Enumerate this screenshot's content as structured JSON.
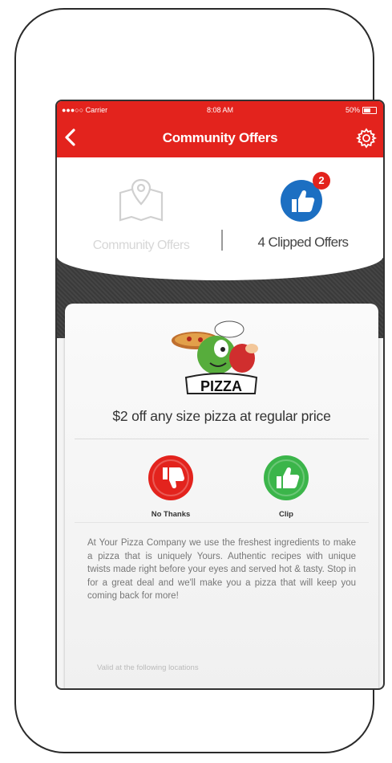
{
  "status_bar": {
    "carrier": "●●●○○ Carrier",
    "time": "8:08 AM",
    "battery": "50%"
  },
  "nav": {
    "title": "Community Offers"
  },
  "tabs": {
    "community": {
      "label": "Community Offers"
    },
    "clipped": {
      "label": "4 Clipped Offers",
      "badge": "2"
    }
  },
  "logo": {
    "text": "PIZZA"
  },
  "offer": {
    "headline": "$2 off any size pizza at regular price",
    "actions": {
      "no_thanks": "No Thanks",
      "clip": "Clip"
    },
    "description": "At Your Pizza Company we use the freshest ingredients to make a pizza that is uniquely Yours. Authentic recipes with unique twists made right before your eyes and served hot & tasty. Stop in for a great deal and we'll make you a pizza that will keep you coming back for more!",
    "valid_text": "Valid at the following locations"
  },
  "colors": {
    "brand_red": "#e3231d",
    "clip_green": "#3bb54a",
    "thumb_blue": "#1c6fc2"
  }
}
